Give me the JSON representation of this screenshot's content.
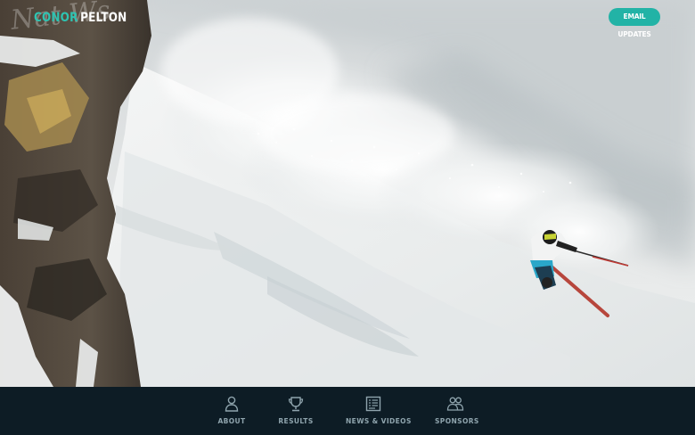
{
  "brand": {
    "first_name": "CONOR",
    "last_name": "PELTON",
    "accent_color": "#2ec4b2"
  },
  "header": {
    "email_button_label": "EMAIL UPDATES"
  },
  "hero": {
    "image_description": ""
  },
  "nav": {
    "items": [
      {
        "label": "ABOUT",
        "icon": "person-icon"
      },
      {
        "label": "RESULTS",
        "icon": "trophy-icon"
      },
      {
        "label": "NEWS & VIDEOS",
        "icon": "news-icon"
      },
      {
        "label": "SPONSORS",
        "icon": "group-icon"
      }
    ]
  }
}
